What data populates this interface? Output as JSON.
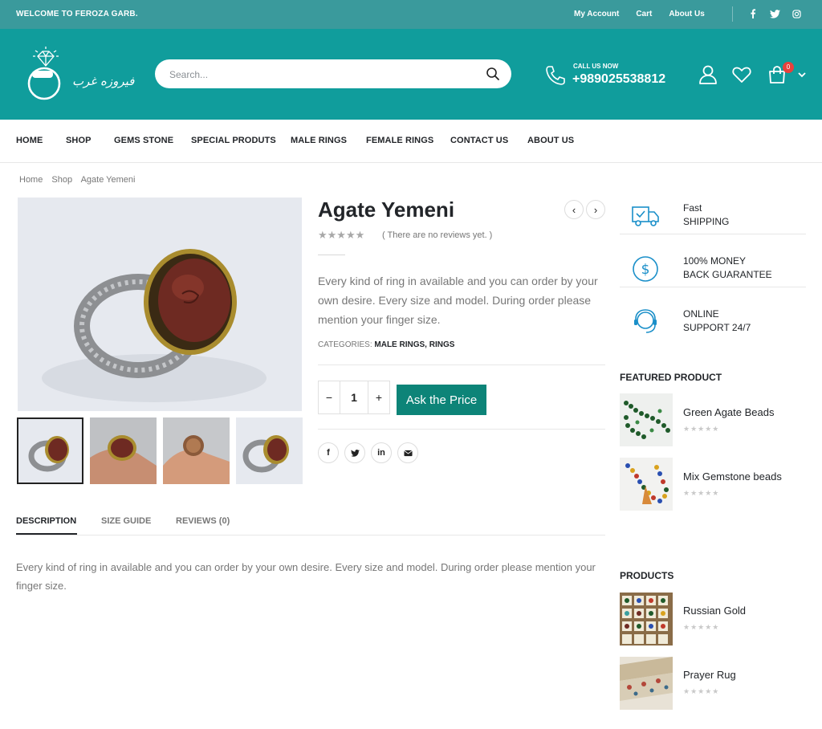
{
  "topbar": {
    "welcome": "WELCOME TO FEROZA GARB.",
    "links": [
      "My Account",
      "Cart",
      "About Us"
    ],
    "social_icons": [
      "facebook-icon",
      "twitter-icon",
      "instagram-icon"
    ]
  },
  "header": {
    "logo_name": "فیروزه غرب",
    "search_placeholder": "Search...",
    "call_label": "CALL US NOW",
    "call_number": "+989025538812",
    "cart_count": "0"
  },
  "nav": [
    "HOME",
    "SHOP",
    "GEMS STONE",
    "SPECIAL PRODUTS",
    "MALE RINGS",
    "FEMALE RINGS",
    "CONTACT US",
    "ABOUT US"
  ],
  "breadcrumb": [
    "Home",
    "Shop",
    "Agate Yemeni"
  ],
  "product": {
    "title": "Agate Yemeni",
    "rating_stars": "★★★★★",
    "reviews_text": "( There are no reviews yet. )",
    "short_description": "Every kind of ring in available and you can order by your own desire. Every size and model. During order please mention your finger size.",
    "categories_label": "CATEGORIES:",
    "categories": "MALE RINGS, RINGS",
    "quantity": "1",
    "ask_button": "Ask the Price"
  },
  "tabs": {
    "items": [
      "DESCRIPTION",
      "SIZE GUIDE",
      "REVIEWS (0)"
    ],
    "description": "Every kind of ring in available and you can order by your own desire. Every size and model. During order please mention your finger size."
  },
  "sidebar": {
    "services": [
      {
        "line1": "Fast",
        "line2": "SHIPPING"
      },
      {
        "line1": "100% MONEY",
        "line2": "BACK GUARANTEE"
      },
      {
        "line1": "ONLINE",
        "line2": "SUPPORT 24/7"
      }
    ],
    "featured_heading": "FEATURED PRODUCT",
    "featured": [
      "Green Agate Beads",
      "Mix Gemstone beads"
    ],
    "products_heading": "PRODUCTS",
    "products": [
      "Russian Gold",
      "Prayer Rug"
    ],
    "empty_stars": "★★★★★"
  },
  "colors": {
    "topbar": "#3a9a9c",
    "header": "#109d9c",
    "button": "#0d8478",
    "badge": "#e8413c"
  }
}
